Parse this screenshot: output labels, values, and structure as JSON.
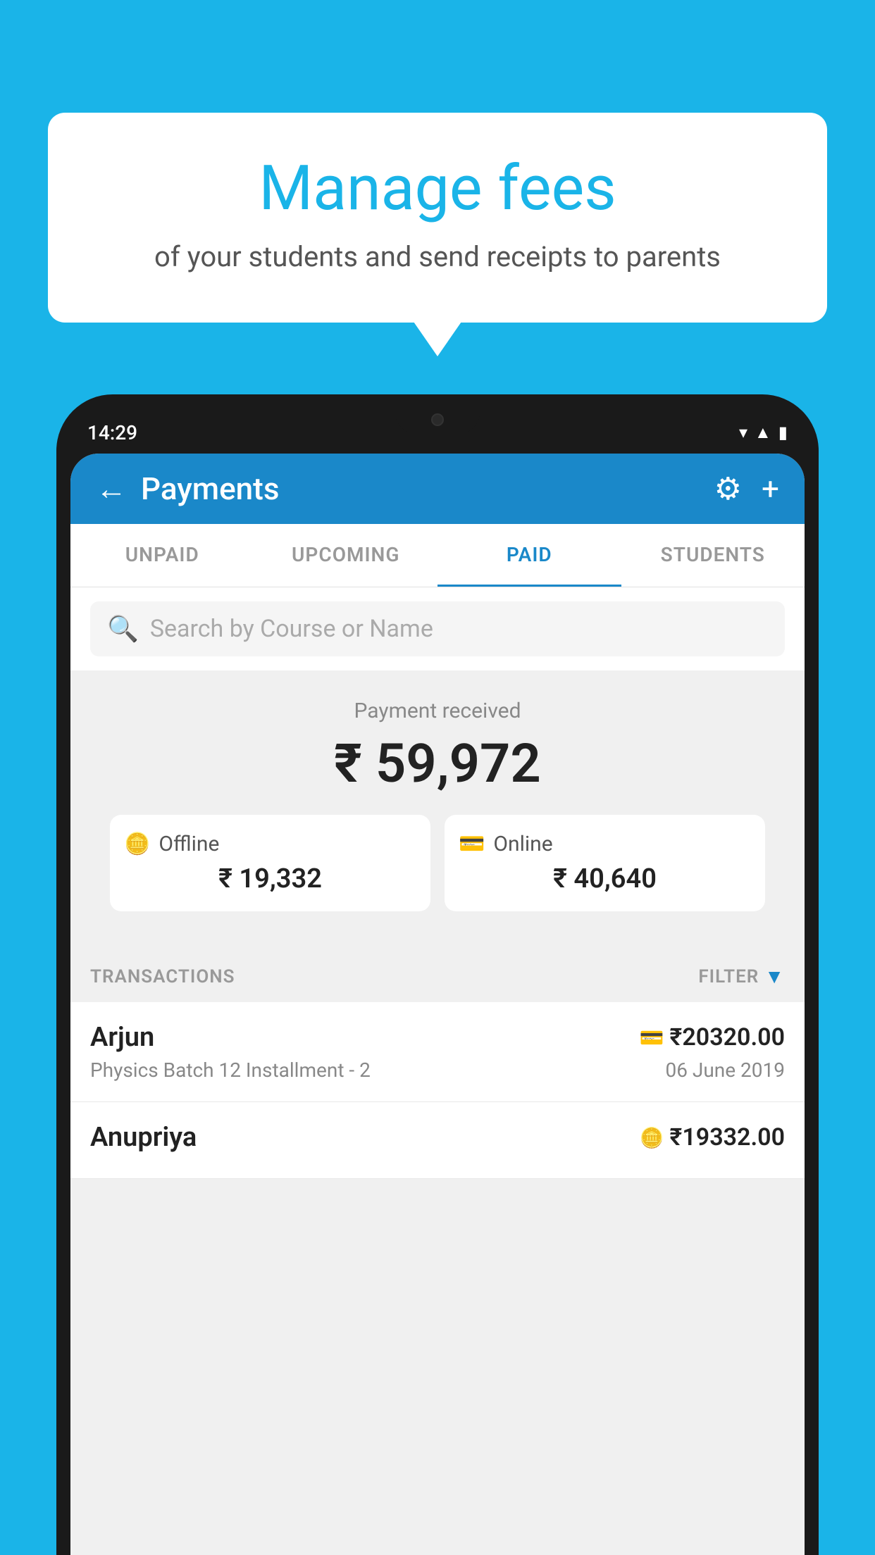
{
  "page": {
    "background_color": "#1ab4e8"
  },
  "bubble": {
    "title": "Manage fees",
    "subtitle": "of your students and send receipts to parents"
  },
  "status_bar": {
    "time": "14:29",
    "icons": [
      "wifi",
      "signal",
      "battery"
    ]
  },
  "app_bar": {
    "title": "Payments",
    "back_label": "←",
    "settings_label": "⚙",
    "add_label": "+"
  },
  "tabs": [
    {
      "label": "UNPAID",
      "active": false
    },
    {
      "label": "UPCOMING",
      "active": false
    },
    {
      "label": "PAID",
      "active": true
    },
    {
      "label": "STUDENTS",
      "active": false
    }
  ],
  "search": {
    "placeholder": "Search by Course or Name"
  },
  "payment_summary": {
    "label": "Payment received",
    "amount": "₹ 59,972",
    "offline_label": "Offline",
    "offline_amount": "₹ 19,332",
    "online_label": "Online",
    "online_amount": "₹ 40,640"
  },
  "transactions_header": {
    "label": "TRANSACTIONS",
    "filter_label": "FILTER"
  },
  "transactions": [
    {
      "name": "Arjun",
      "amount": "₹20320.00",
      "course": "Physics Batch 12 Installment - 2",
      "date": "06 June 2019",
      "payment_type": "card"
    },
    {
      "name": "Anupriya",
      "amount": "₹19332.00",
      "course": "",
      "date": "",
      "payment_type": "offline"
    }
  ]
}
